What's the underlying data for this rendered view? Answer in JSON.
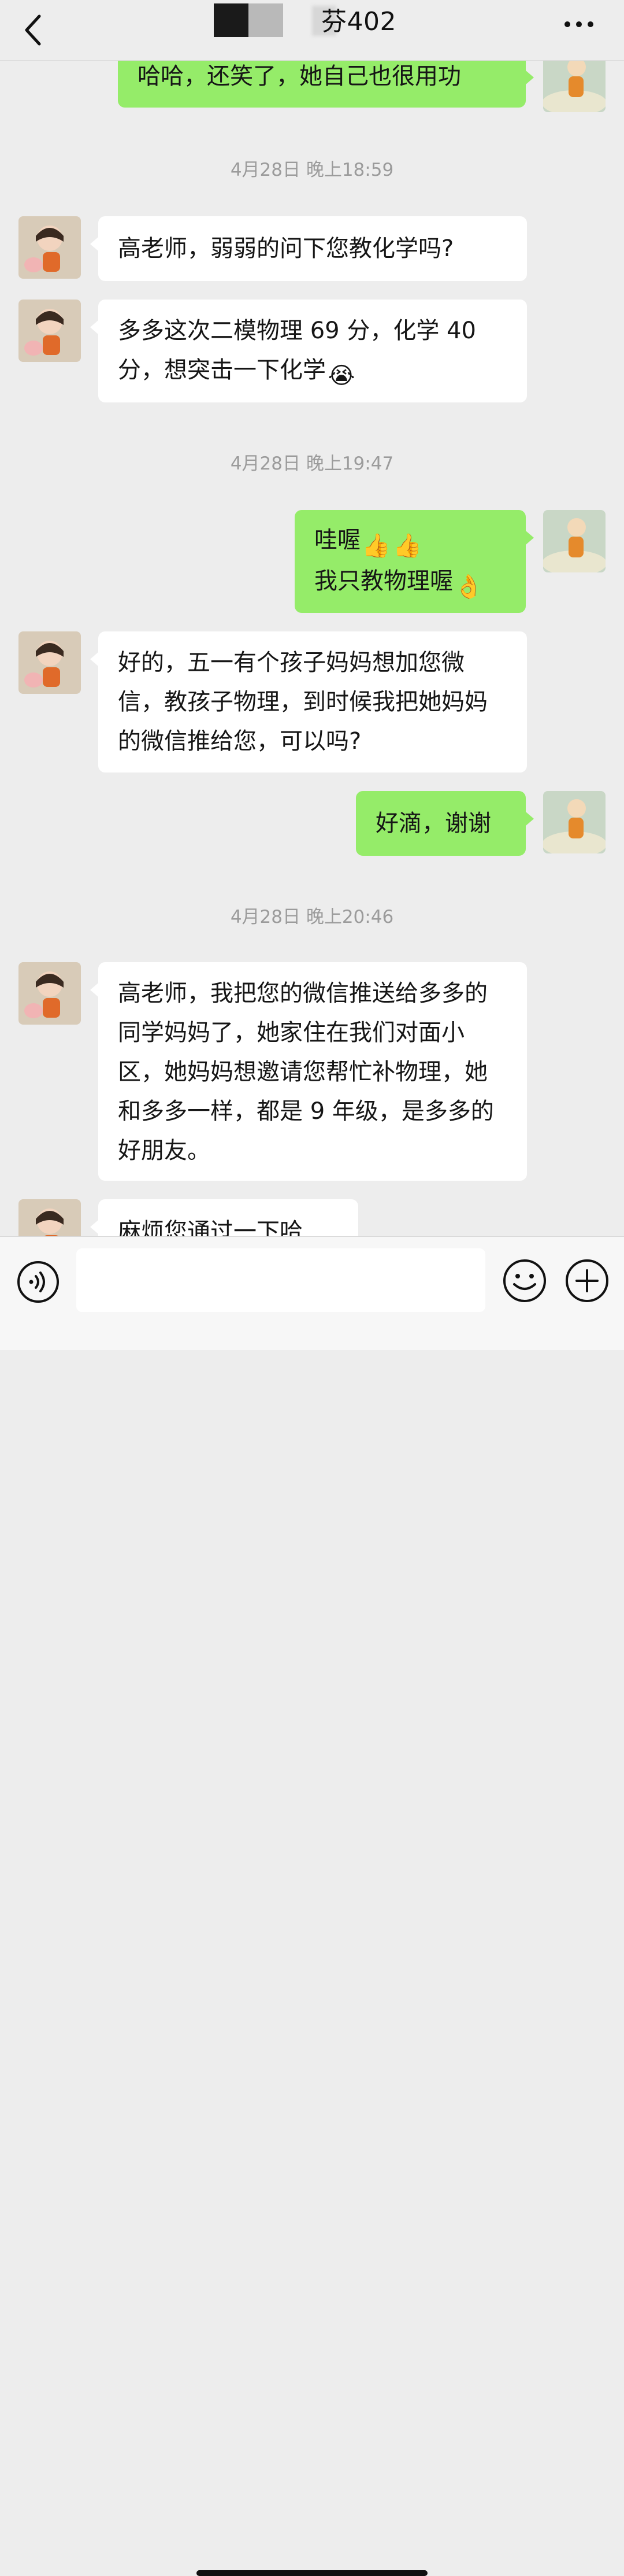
{
  "header": {
    "title": "芬402",
    "back_icon": "chevron-left-icon",
    "more_icon": "ellipsis-icon"
  },
  "messages": [
    {
      "side": "right",
      "text": "哈哈，还笑了，她自己也很用功"
    },
    {
      "type": "time",
      "text": "4月28日 晚上18:59"
    },
    {
      "side": "left",
      "text": "高老师，弱弱的问下您教化学吗?"
    },
    {
      "side": "left",
      "text": "多多这次二模物理 69 分，化学 40 分，想突击一下化学",
      "emoji": "😭"
    },
    {
      "type": "time",
      "text": "4月28日 晚上19:47"
    },
    {
      "side": "right",
      "line1": "哇喔",
      "line2": "我只教物理喔",
      "emoji1": "👍",
      "emoji2": "👌"
    },
    {
      "side": "left",
      "text": "好的，五一有个孩子妈妈想加您微信，教孩子物理，到时候我把她妈妈的微信推给您，可以吗?"
    },
    {
      "side": "right",
      "text": "好滴，谢谢"
    },
    {
      "type": "time",
      "text": "4月28日 晚上20:46"
    },
    {
      "side": "left",
      "text": "高老师，我把您的微信推送给多多的同学妈妈了，她家住在我们对面小区，她妈妈想邀请您帮忙补物理，她和多多一样，都是 9 年级，是多多的好朋友。"
    },
    {
      "side": "left",
      "text": "麻烦您通过一下哈"
    }
  ],
  "colors": {
    "background": "#ededed",
    "bubble_self": "#95ec69",
    "bubble_other": "#ffffff"
  },
  "inputbar": {
    "voice_icon": "voice-icon",
    "emoji_icon": "smiley-icon",
    "plus_icon": "plus-icon",
    "input_value": ""
  }
}
